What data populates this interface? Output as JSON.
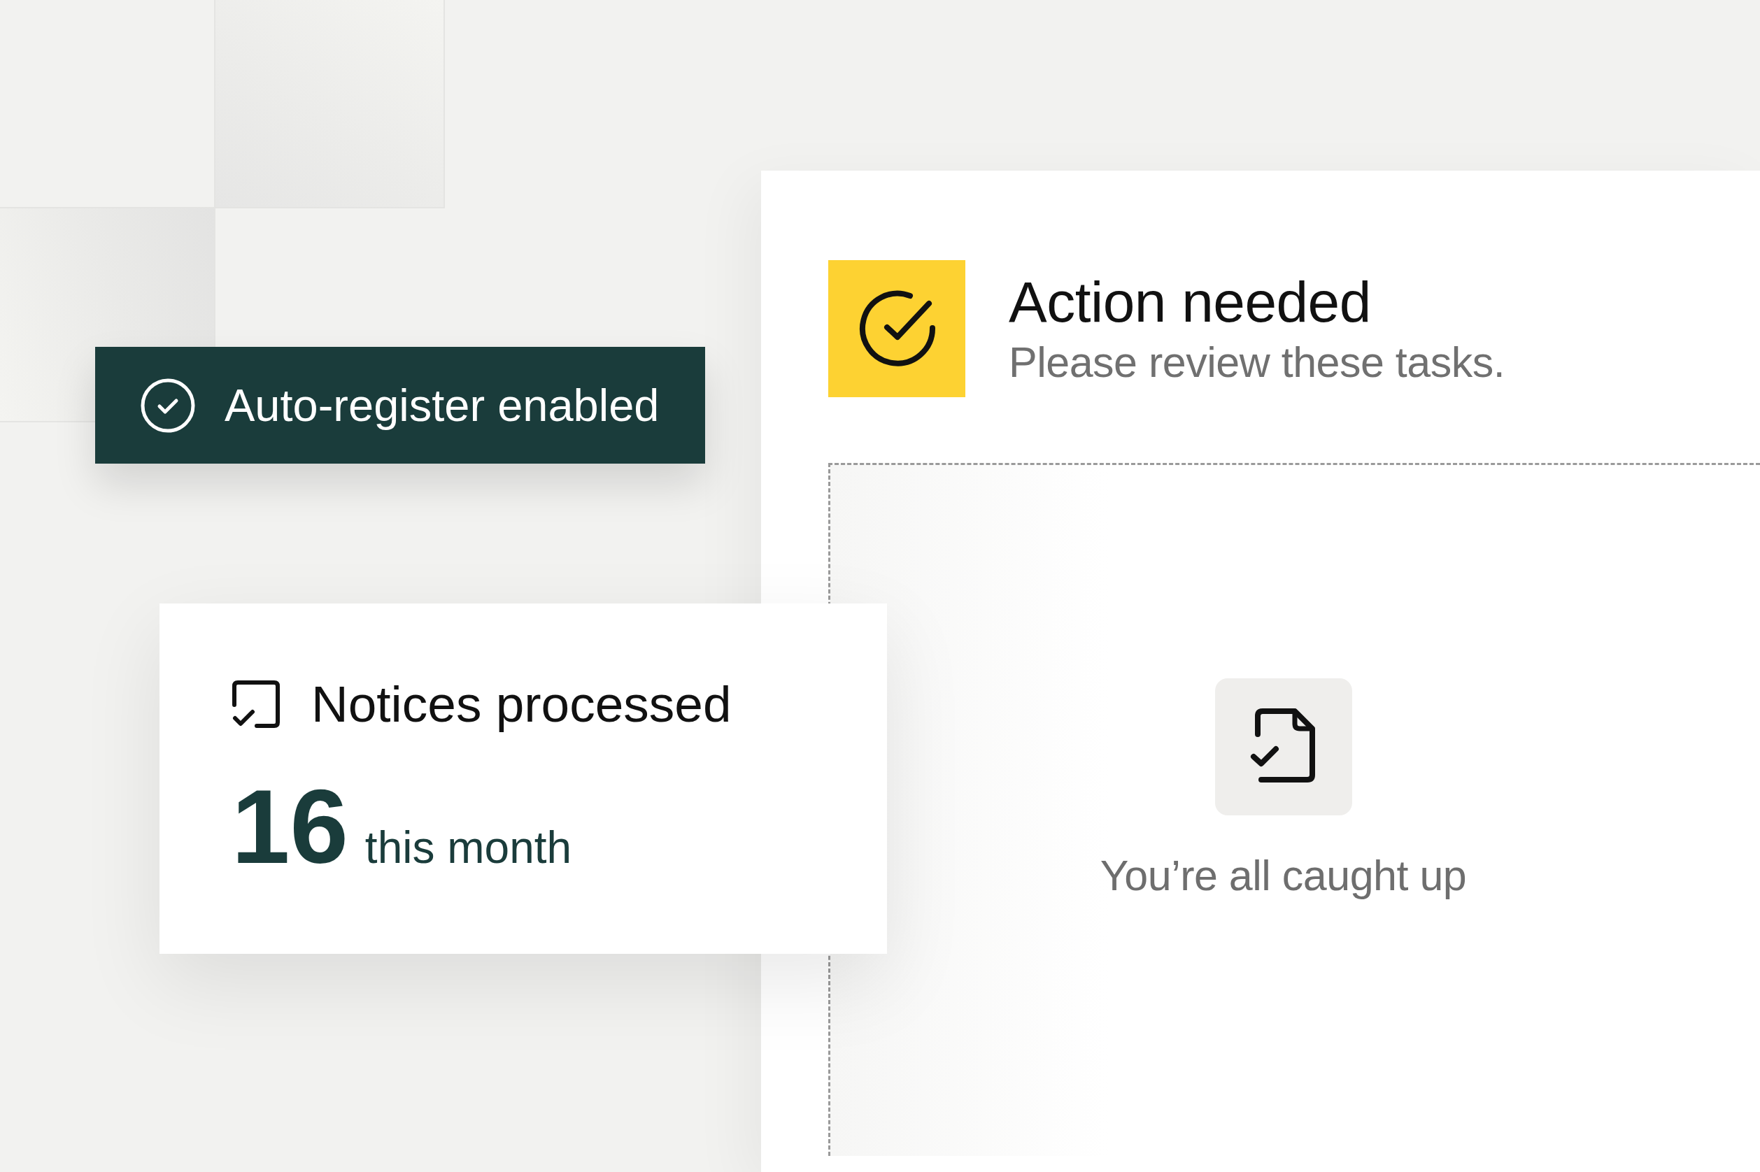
{
  "status_banner": {
    "label": "Auto-register enabled"
  },
  "stat_card": {
    "title": "Notices processed",
    "value": "16",
    "caption": "this month"
  },
  "tasks_panel": {
    "title": "Action needed",
    "subtitle": "Please review these tasks.",
    "empty_state": {
      "message": "You’re all caught up"
    }
  }
}
